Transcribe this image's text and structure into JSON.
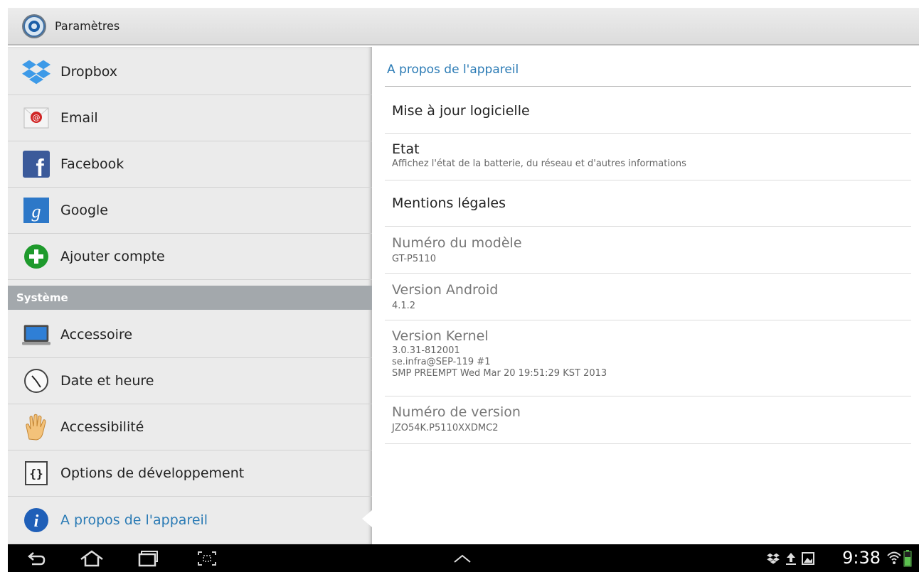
{
  "actionbar": {
    "title": "Paramètres",
    "icon": "settings-gear-icon"
  },
  "sidebar": {
    "items": [
      {
        "label": "Dropbox",
        "icon": "dropbox-icon"
      },
      {
        "label": "Email",
        "icon": "email-icon"
      },
      {
        "label": "Facebook",
        "icon": "facebook-icon"
      },
      {
        "label": "Google",
        "icon": "google-icon"
      },
      {
        "label": "Ajouter compte",
        "icon": "add-account-icon"
      }
    ],
    "section_header": "Système",
    "system_items": [
      {
        "label": "Accessoire",
        "icon": "accessory-icon"
      },
      {
        "label": "Date et heure",
        "icon": "clock-icon"
      },
      {
        "label": "Accessibilité",
        "icon": "hand-icon"
      },
      {
        "label": "Options de développement",
        "icon": "braces-icon"
      },
      {
        "label": "A propos de l'appareil",
        "icon": "info-icon",
        "selected": true
      }
    ]
  },
  "detail": {
    "header": "A propos de l'appareil",
    "items": [
      {
        "title": "Mise à jour logicielle"
      },
      {
        "title": "Etat",
        "summary": "Affichez l'état de la batterie, du réseau et d'autres informations"
      },
      {
        "title": "Mentions légales"
      },
      {
        "title": "Numéro du modèle",
        "value": "GT-P5110"
      },
      {
        "title": "Version Android",
        "value": "4.1.2"
      },
      {
        "title": "Version Kernel",
        "value_lines": [
          "3.0.31-812001",
          "se.infra@SEP-119 #1",
          "SMP PREEMPT Wed Mar 20 19:51:29 KST 2013"
        ]
      },
      {
        "title": "Numéro de version",
        "value": "JZO54K.P5110XXDMC2"
      }
    ]
  },
  "navbar": {
    "buttons": [
      "back-icon",
      "home-icon",
      "recent-apps-icon",
      "screenshot-icon",
      "expand-up-icon"
    ],
    "status_icons": [
      "dropbox-status-icon",
      "upload-icon",
      "image-icon",
      "wifi-icon",
      "battery-icon"
    ],
    "time": "9:38"
  },
  "colors": {
    "accent": "#2b7bb5",
    "section": "#a3a8ac",
    "pane": "#ebebeb"
  }
}
